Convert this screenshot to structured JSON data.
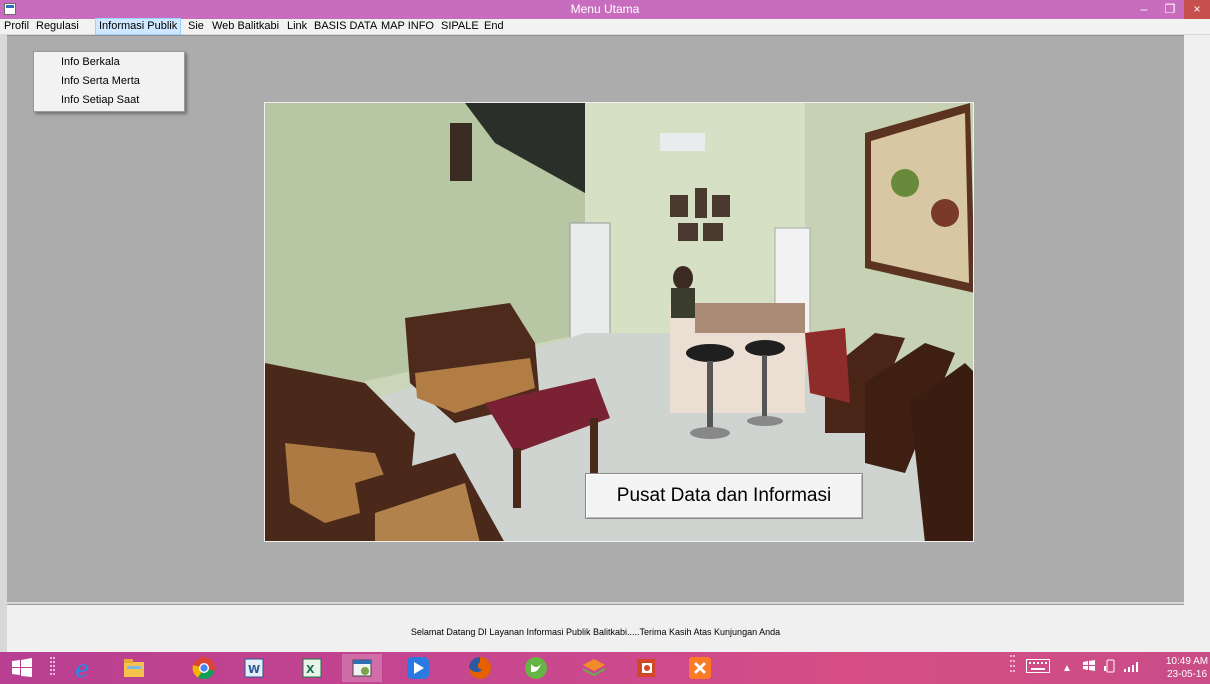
{
  "window": {
    "title": "Menu Utama",
    "minimize_glyph": "–",
    "maximize_glyph": "❐",
    "close_glyph": "×"
  },
  "menubar": {
    "items": [
      "Profil",
      "Regulasi",
      "Informasi Publik",
      "Sie",
      "Web Balitkabi",
      "Link",
      "BASIS DATA",
      "MAP INFO",
      "SIPALE",
      "End"
    ],
    "active": "Informasi Publik"
  },
  "dropdown": {
    "items": [
      "Info Berkala",
      "Info Serta Merta",
      "Info Setiap Saat"
    ]
  },
  "main": {
    "caption": "Pusat Data dan Informasi"
  },
  "statusbar": {
    "text": "Selamat Datang DI Layanan Informasi Publik Balitkabi.....Terima Kasih Atas Kunjungan Anda"
  },
  "taskbar": {
    "apps": [
      "start-icon",
      "internet-explorer-icon",
      "file-explorer-icon",
      "chrome-icon",
      "word-icon",
      "excel-icon",
      "vb6-app-icon",
      "d-app-icon",
      "firefox-icon",
      "green-app-icon",
      "stack-app-icon",
      "powerpoint-icon",
      "xampp-icon"
    ],
    "clock_time": "10:49 AM",
    "clock_date": "23-05-16"
  },
  "colors": {
    "titlebar": "#c86dbe",
    "taskbar": "#c9488f",
    "mdi_background": "#acacac",
    "menu_highlight": "#cde8ff"
  }
}
